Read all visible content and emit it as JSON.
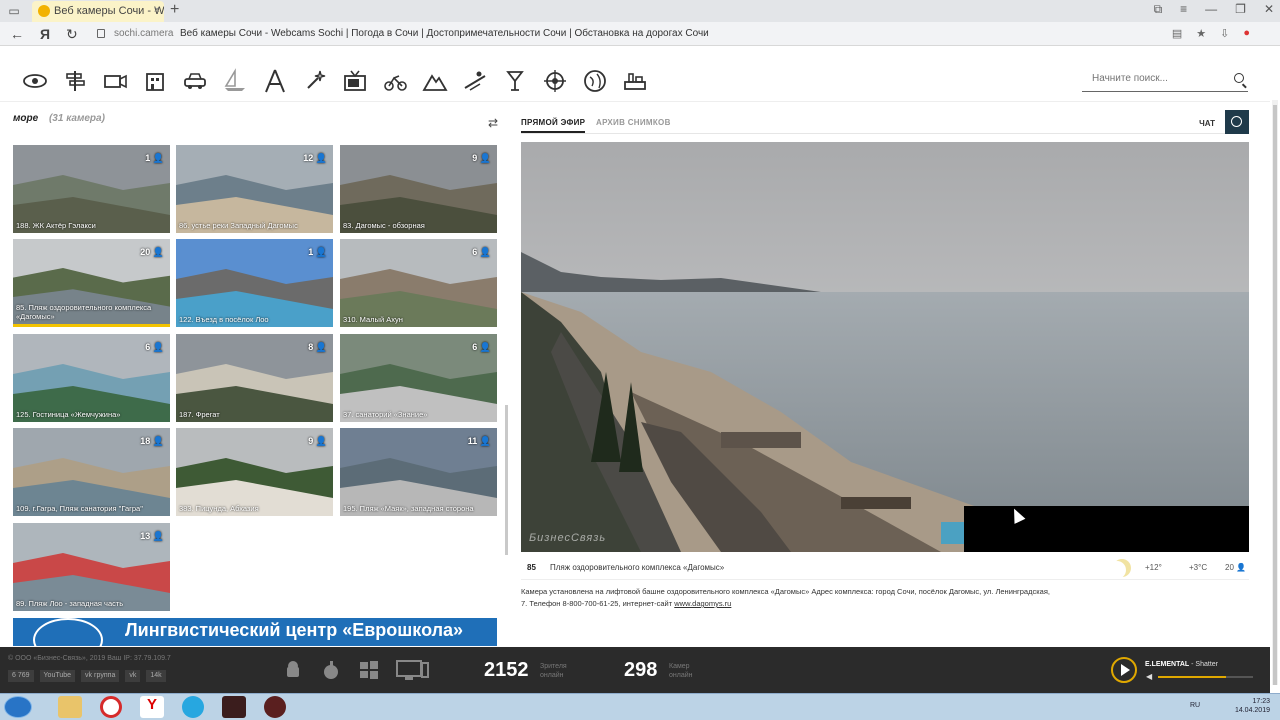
{
  "browser": {
    "tab_title": "Веб камеры Сочи - Web",
    "tab_close": "×",
    "new_tab": "+",
    "back": "←",
    "ya": "Я",
    "reload": "↻",
    "url": "sochi.camera",
    "page_title": "Веб камеры Сочи - Webcams Sochi | Погода в Сочи | Достопримечательности Сочи | Обстановка на дорогах Сочи"
  },
  "nav": {
    "icons": [
      "eye-icon",
      "signpost-icon",
      "camera-icon",
      "building-icon",
      "car-icon",
      "boat-icon",
      "tower-icon",
      "sparkle-icon",
      "tv-icon",
      "bike-icon",
      "mountain-icon",
      "ski-icon",
      "glass-icon",
      "target-icon",
      "globe-icon",
      "port-icon"
    ]
  },
  "search": {
    "placeholder": "Начните поиск..."
  },
  "left": {
    "heading": "море",
    "count": "(31 камера)",
    "shuffle": "⇄",
    "cameras": [
      {
        "caption": "188. ЖК Актёр Гэлакси",
        "viewers": "1"
      },
      {
        "caption": "86. устье реки Западный Дагомыс",
        "viewers": "12"
      },
      {
        "caption": "83. Дагомыс - обзорная",
        "viewers": "9"
      },
      {
        "caption": "85. Пляж оздоровительного комплекса «Дагомыс»",
        "viewers": "20"
      },
      {
        "caption": "122. Въезд в посёлок Лоо",
        "viewers": "1"
      },
      {
        "caption": "310. Малый Ахун",
        "viewers": "6"
      },
      {
        "caption": "125. Гостиница «Жемчужина»",
        "viewers": "6"
      },
      {
        "caption": "187. Фрегат",
        "viewers": "8"
      },
      {
        "caption": "37. санаторий «Знание»",
        "viewers": "6"
      },
      {
        "caption": "109. г.Гагра, Пляж санатория \"Гагра\"",
        "viewers": "18"
      },
      {
        "caption": "383. Пицунда, Абхазия",
        "viewers": "9"
      },
      {
        "caption": "195. Пляж «Маяк», западная сторона",
        "viewers": "11"
      },
      {
        "caption": "89. Пляж Лоо - западная часть",
        "viewers": "13"
      }
    ]
  },
  "banner": {
    "text": "Лингвистический центр «Еврошкола»"
  },
  "right": {
    "tab_live": "ПРЯМОЙ ЭФИР",
    "tab_archive": "АРХИВ СНИМКОВ",
    "chat": "ЧАТ",
    "watermark": "БизнесСвязь",
    "cam_number": "85",
    "cam_name": "Пляж оздоровительного комплекса «Дагомыс»",
    "weather_air": "+12°",
    "weather_sea": "+3°C",
    "viewers": "20",
    "desc_1": "Камера установлена на лифтовой башне оздоровительного комплекса «Дагомыс» Адрес комплекса: город Сочи, посёлок Дагомыс, ул. Ленинградская,",
    "desc_2": "7. Телефон 8-800-700-61-25, интернет-сайт",
    "desc_link": "www.dagomys.ru"
  },
  "footer": {
    "copyright": "© ООО «Бизнес-Связь», 2019 Ваш IP: 37.79.109.7",
    "badges": [
      "6 769",
      "YouTube",
      "vk группа",
      "vk",
      "14k"
    ],
    "watchers_num": "2152",
    "watchers_label_1": "Зрителя",
    "watchers_label_2": "онлайн",
    "cams_num": "298",
    "cams_label_1": "Камер",
    "cams_label_2": "онлайн",
    "track_artist": "E.LEMENTAL",
    "track_title": " - Shatter",
    "volume": 0.72,
    "accent": "#e0a800"
  },
  "taskbar": {
    "lang": "RU",
    "time": "17:23",
    "date": "14.04.2019"
  }
}
